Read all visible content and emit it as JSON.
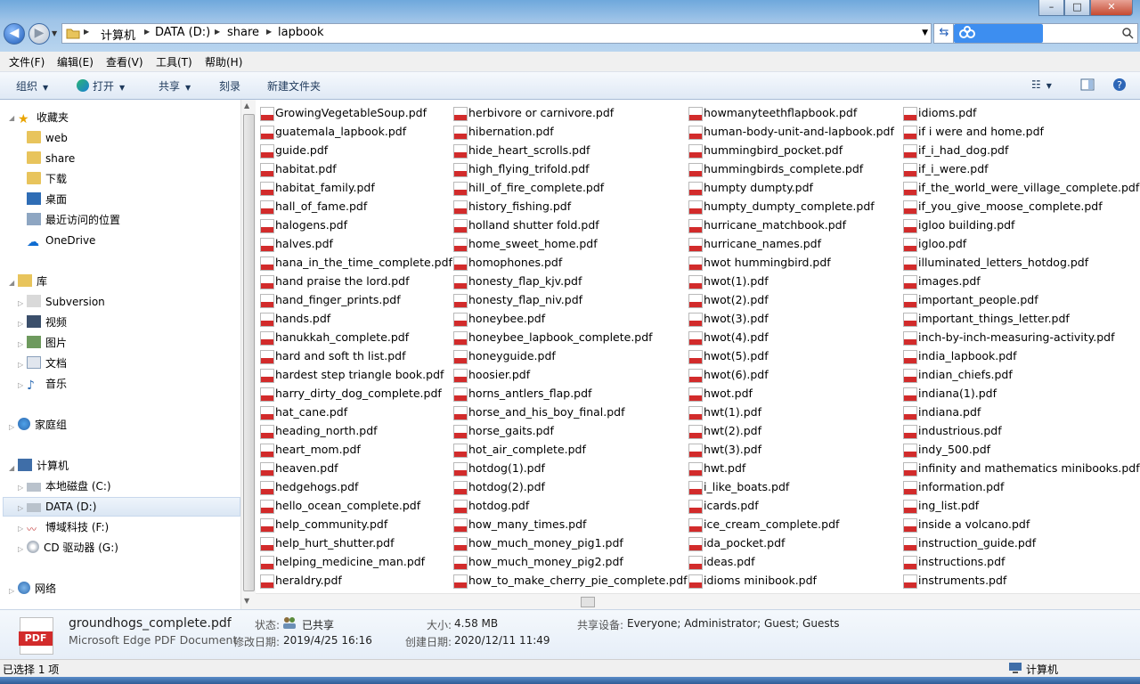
{
  "address": {
    "crumbs": [
      "计算机",
      "DATA (D:)",
      "share",
      "lapbook"
    ]
  },
  "window_buttons": {
    "minimize": "–",
    "maximize": "□",
    "close": "✕"
  },
  "menu": [
    "文件(F)",
    "编辑(E)",
    "查看(V)",
    "工具(T)",
    "帮助(H)"
  ],
  "toolbar": {
    "organize": "组织",
    "open": "打开",
    "share": "共享",
    "burn": "刻录",
    "new_folder": "新建文件夹"
  },
  "nav": {
    "favorites": "收藏夹",
    "fav_items": [
      "web",
      "share",
      "下载",
      "桌面",
      "最近访问的位置"
    ],
    "onedrive": "OneDrive",
    "library": "库",
    "lib_items": [
      "Subversion",
      "视频",
      "图片",
      "文档",
      "音乐"
    ],
    "homegroup": "家庭组",
    "computer": "计算机",
    "drives": [
      "本地磁盘 (C:)",
      "DATA (D:)",
      "博域科技 (F:)",
      "CD 驱动器 (G:)"
    ],
    "network": "网络"
  },
  "files": [
    [
      "GrowingVegetableSoup.pdf",
      "guatemala_lapbook.pdf",
      "guide.pdf",
      "habitat.pdf",
      "habitat_family.pdf",
      "hall_of_fame.pdf",
      "halogens.pdf",
      "halves.pdf",
      "hana_in_the_time_complete.pdf",
      "hand praise the lord.pdf",
      "hand_finger_prints.pdf",
      "hands.pdf",
      "hanukkah_complete.pdf",
      "hard and soft th list.pdf",
      "hardest step triangle book.pdf",
      "harry_dirty_dog_complete.pdf",
      "hat_cane.pdf",
      "heading_north.pdf",
      "heart_mom.pdf",
      "heaven.pdf",
      "hedgehogs.pdf",
      "hello_ocean_complete.pdf",
      "help_community.pdf",
      "help_hurt_shutter.pdf",
      "helping_medicine_man.pdf",
      "heraldry.pdf"
    ],
    [
      "herbivore or carnivore.pdf",
      "hibernation.pdf",
      "hide_heart_scrolls.pdf",
      "high_flying_trifold.pdf",
      "hill_of_fire_complete.pdf",
      "history_fishing.pdf",
      "holland shutter fold.pdf",
      "home_sweet_home.pdf",
      "homophones.pdf",
      "honesty_flap_kjv.pdf",
      "honesty_flap_niv.pdf",
      "honeybee.pdf",
      "honeybee_lapbook_complete.pdf",
      "honeyguide.pdf",
      "hoosier.pdf",
      "horns_antlers_flap.pdf",
      "horse_and_his_boy_final.pdf",
      "horse_gaits.pdf",
      "hot_air_complete.pdf",
      "hotdog(1).pdf",
      "hotdog(2).pdf",
      "hotdog.pdf",
      "how_many_times.pdf",
      "how_much_money_pig1.pdf",
      "how_much_money_pig2.pdf",
      "how_to_make_cherry_pie_complete.pdf"
    ],
    [
      "howmanyteethflapbook.pdf",
      "human-body-unit-and-lapbook.pdf",
      "hummingbird_pocket.pdf",
      "hummingbirds_complete.pdf",
      "humpty dumpty.pdf",
      "humpty_dumpty_complete.pdf",
      "hurricane_matchbook.pdf",
      "hurricane_names.pdf",
      "hwot hummingbird.pdf",
      "hwot(1).pdf",
      "hwot(2).pdf",
      "hwot(3).pdf",
      "hwot(4).pdf",
      "hwot(5).pdf",
      "hwot(6).pdf",
      "hwot.pdf",
      "hwt(1).pdf",
      "hwt(2).pdf",
      "hwt(3).pdf",
      "hwt.pdf",
      "i_like_boats.pdf",
      "icards.pdf",
      "ice_cream_complete.pdf",
      "ida_pocket.pdf",
      "ideas.pdf",
      "idioms minibook.pdf"
    ],
    [
      "idioms.pdf",
      "if i were and home.pdf",
      "if_i_had_dog.pdf",
      "if_i_were.pdf",
      "if_the_world_were_village_complete.pdf",
      "if_you_give_moose_complete.pdf",
      "igloo building.pdf",
      "igloo.pdf",
      "illuminated_letters_hotdog.pdf",
      "images.pdf",
      "important_people.pdf",
      "important_things_letter.pdf",
      "inch-by-inch-measuring-activity.pdf",
      "india_lapbook.pdf",
      "indian_chiefs.pdf",
      "indiana(1).pdf",
      "indiana.pdf",
      "industrious.pdf",
      "indy_500.pdf",
      "infinity and mathematics minibooks.pdf",
      "information.pdf",
      "ing_list.pdf",
      "inside a volcano.pdf",
      "instruction_guide.pdf",
      "instructions.pdf",
      "instruments.pdf"
    ]
  ],
  "details": {
    "icon_label": "PDF",
    "filename": "groundhogs_complete.pdf",
    "filetype": "Microsoft Edge PDF Document",
    "status_label": "状态:",
    "status_value": "已共享",
    "modified_label": "修改日期:",
    "modified_value": "2019/4/25 16:16",
    "size_label": "大小:",
    "size_value": "4.58 MB",
    "created_label": "创建日期:",
    "created_value": "2020/12/11 11:49",
    "shared_label": "共享设备:",
    "shared_value": "Everyone; Administrator; Guest; Guests"
  },
  "status": {
    "selected": "已选择 1 项",
    "computer": "计算机"
  }
}
